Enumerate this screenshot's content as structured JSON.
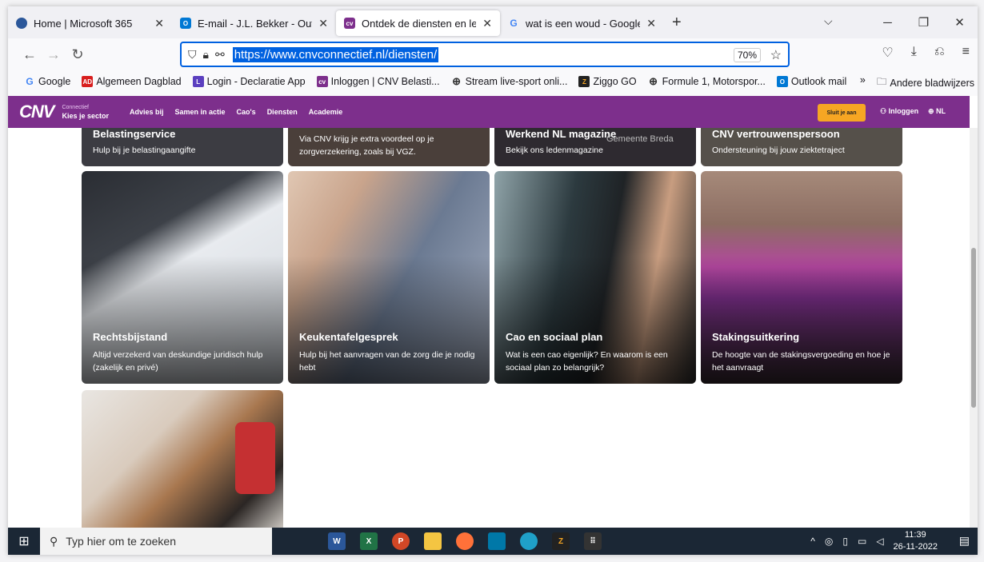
{
  "browser": {
    "tabs": [
      {
        "title": "Home | Microsoft 365",
        "fav_color": "#2b579a",
        "fav_text": "",
        "active": false
      },
      {
        "title": "E-mail - J.L. Bekker - Outlook",
        "fav_color": "#0078d4",
        "fav_text": "O",
        "active": false
      },
      {
        "title": "Ontdek de diensten en ledenvo",
        "fav_color": "#7d2f8c",
        "fav_text": "cv",
        "active": true
      },
      {
        "title": "wat is een woud - Google Zoek",
        "fav_color": "#ffffff",
        "fav_text": "G",
        "active": false
      }
    ],
    "url": "https://www.cnvconnectief.nl/diensten/",
    "zoom": "70%",
    "bookmarks": [
      {
        "label": "Google",
        "color": "#ffffff",
        "text": "G"
      },
      {
        "label": "Algemeen Dagblad",
        "color": "#d81e1e",
        "text": "AD"
      },
      {
        "label": "Login - Declaratie App",
        "color": "#5b3fbf",
        "text": "L"
      },
      {
        "label": "Inloggen | CNV Belasti...",
        "color": "#7d2f8c",
        "text": "cv"
      },
      {
        "label": "Stream live-sport onli...",
        "color": "#ffffff",
        "text": "⊕"
      },
      {
        "label": "Ziggo GO",
        "color": "#222222",
        "text": "Z"
      },
      {
        "label": "Formule 1, Motorspor...",
        "color": "#ffffff",
        "text": "⊕"
      },
      {
        "label": "Outlook mail",
        "color": "#0078d4",
        "text": "O"
      }
    ],
    "other_bookmarks": "Andere bladwijzers"
  },
  "site": {
    "logo": "CNV",
    "sector_small": "Connectief",
    "sector_big": "Kies je sector",
    "menu": [
      "Advies bij",
      "Samen in actie",
      "Cao's",
      "Diensten",
      "Academie"
    ],
    "join": "Sluit je aan",
    "login": "Inloggen",
    "lang": "NL"
  },
  "cards_top": [
    {
      "title": "Belastingservice",
      "desc": "Hulp bij je belastingaangifte",
      "bg": "#3c3c42"
    },
    {
      "title": "",
      "desc": "Via CNV krijg je extra voordeel op je zorgverzekering, zoals bij VGZ.",
      "bg": "#4a3f3a"
    },
    {
      "title": "Werkend NL magazine",
      "desc": "Bekijk ons ledenmagazine",
      "bg": "#2e2a30"
    },
    {
      "title": "CNV vertrouwenspersoon",
      "desc": "Ondersteuning bij jouw ziektetraject",
      "bg": "#55504a"
    }
  ],
  "overlay_text": "Gemeente Breda",
  "cards_mid": [
    {
      "title": "Rechtsbijstand",
      "desc": "Altijd verzekerd van deskundige juridisch hulp (zakelijk en privé)",
      "bg": "#d9dde3"
    },
    {
      "title": "Keukentafelgesprek",
      "desc": "Hulp bij het aanvragen van de zorg die je nodig hebt",
      "bg": "#7f8a9c"
    },
    {
      "title": "Cao en sociaal plan",
      "desc": "Wat is een cao eigenlijk? En waarom is een sociaal plan zo belangrijk?",
      "bg": "#5a6b72"
    },
    {
      "title": "Stakingsuitkering",
      "desc": "De hoogte van de stakingsvergoeding en hoe je het aanvraagt",
      "bg": "#8a4f7a"
    }
  ],
  "taskbar": {
    "search_placeholder": "Typ hier om te zoeken",
    "time": "11:39",
    "date": "26-11-2022"
  }
}
